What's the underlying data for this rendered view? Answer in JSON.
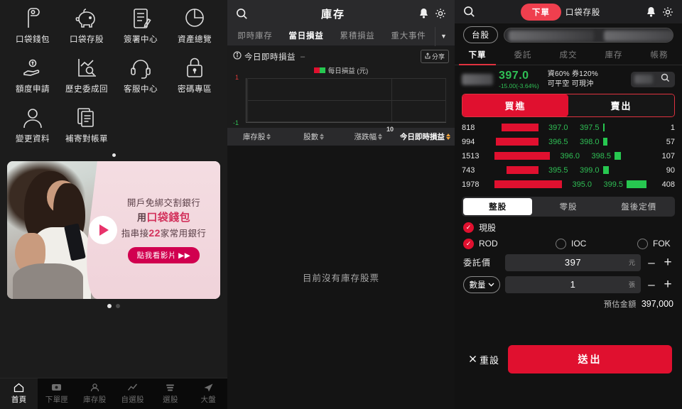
{
  "left": {
    "menu": [
      {
        "label": "口袋錢包",
        "icon": "wallet-icon"
      },
      {
        "label": "口袋存股",
        "icon": "piggy-bank-icon"
      },
      {
        "label": "簽署中心",
        "icon": "sign-document-icon"
      },
      {
        "label": "資產總覽",
        "icon": "pie-chart-icon"
      },
      {
        "label": "額度申請",
        "icon": "hand-coin-icon"
      },
      {
        "label": "歷史委成回",
        "icon": "chart-search-icon"
      },
      {
        "label": "客服中心",
        "icon": "headset-icon"
      },
      {
        "label": "密碼專區",
        "icon": "lock-icon"
      },
      {
        "label": "變更資料",
        "icon": "user-icon"
      },
      {
        "label": "補寄對帳單",
        "icon": "documents-icon"
      }
    ],
    "menu_pager": {
      "total": 1,
      "current": 1
    },
    "banner": {
      "line1": "開戶免綁交割銀行",
      "line2_pre": "用",
      "line2_strong": "口袋錢包",
      "line3_pre": "指串接",
      "line3_strong": "22",
      "line3_post": "家常用銀行",
      "cta": "點我看影片",
      "cta_arrow": "▶▶",
      "play_icon": "play-icon",
      "pager": {
        "total": 2,
        "current": 1
      }
    },
    "bottom_nav": [
      {
        "label": "首頁",
        "icon": "home-icon",
        "active": true
      },
      {
        "label": "下單匣",
        "icon": "order-box-icon",
        "active": false
      },
      {
        "label": "庫存股",
        "icon": "inventory-icon",
        "active": false
      },
      {
        "label": "自選股",
        "icon": "watchlist-chart-icon",
        "active": false
      },
      {
        "label": "選股",
        "icon": "stack-icon",
        "active": false
      },
      {
        "label": "大盤",
        "icon": "market-arrow-icon",
        "active": false
      }
    ]
  },
  "middle": {
    "header": {
      "title": "庫存",
      "search_icon": "search-icon",
      "bell_icon": "bell-icon",
      "gear_icon": "gear-icon"
    },
    "tabs": [
      {
        "label": "即時庫存",
        "active": false
      },
      {
        "label": "當日損益",
        "active": true
      },
      {
        "label": "累積損益",
        "active": false
      },
      {
        "label": "重大事件",
        "active": false
      }
    ],
    "tabs_more_icon": "chevron-down-icon",
    "chart_panel": {
      "info_icon": "info-icon",
      "title": "今日即時損益",
      "value": "–",
      "share_label": "分享",
      "share_icon": "share-icon"
    },
    "table_headers": [
      {
        "label": "庫存股",
        "active": false
      },
      {
        "label": "股數",
        "active": false
      },
      {
        "label": "漲跌幅",
        "active": false
      },
      {
        "label": "今日即時損益",
        "active": true
      }
    ],
    "empty_text": "目前沒有庫存股票"
  },
  "chart_data": {
    "type": "bar",
    "title": "今日即時損益",
    "legend": [
      "每日損益 (元)"
    ],
    "legend_colors": [
      "#e0102f",
      "#27c750"
    ],
    "categories": [],
    "values": [],
    "x": [
      10
    ],
    "xtick_labels": [
      "10"
    ],
    "ytick_labels": [
      "1",
      "-1"
    ],
    "ylim": [
      -1,
      1
    ],
    "ylabel": "",
    "xlabel": "",
    "grid": true,
    "legend_position": "top-center",
    "note": "No data plotted — empty inventory"
  },
  "right": {
    "header": {
      "search_icon": "search-icon",
      "bell_icon": "bell-icon",
      "gear_icon": "gear-icon",
      "seg_primary": "下單",
      "seg_secondary": "口袋存股"
    },
    "market_chip": "台股",
    "symbol_search_placeholder": "",
    "tabs": [
      {
        "label": "下單",
        "active": true
      },
      {
        "label": "委託",
        "active": false
      },
      {
        "label": "成交",
        "active": false
      },
      {
        "label": "庫存",
        "active": false
      },
      {
        "label": "帳務",
        "active": false
      }
    ],
    "quote": {
      "price": "397.0",
      "change": "-15.00(-3.64%)",
      "margin_line": "資60% 券120%",
      "flags_line": "可平空 可現沖",
      "search_icon": "search-icon"
    },
    "buy_label": "買進",
    "sell_label": "賣出",
    "order_book": {
      "bids": [
        {
          "qty": "818",
          "price": "397.0",
          "bar": 52
        },
        {
          "qty": "994",
          "price": "396.5",
          "bar": 60
        },
        {
          "qty": "1513",
          "price": "396.0",
          "bar": 78
        },
        {
          "qty": "743",
          "price": "395.5",
          "bar": 45
        },
        {
          "qty": "1978",
          "price": "395.0",
          "bar": 95
        }
      ],
      "asks": [
        {
          "price": "397.5",
          "qty": "1",
          "bar": 2
        },
        {
          "price": "398.0",
          "qty": "57",
          "bar": 6
        },
        {
          "price": "398.5",
          "qty": "107",
          "bar": 9
        },
        {
          "price": "399.0",
          "qty": "90",
          "bar": 8
        },
        {
          "price": "399.5",
          "qty": "408",
          "bar": 28
        }
      ]
    },
    "lot_tabs": [
      {
        "label": "整股",
        "active": true
      },
      {
        "label": "零股",
        "active": false
      },
      {
        "label": "盤後定價",
        "active": false
      }
    ],
    "trade_type": {
      "label": "現股",
      "checked": true
    },
    "order_conditions": [
      {
        "label": "ROD",
        "checked": true
      },
      {
        "label": "IOC",
        "checked": false
      },
      {
        "label": "FOK",
        "checked": false
      }
    ],
    "price_field": {
      "label": "委託價",
      "value": "397",
      "unit": "元",
      "minus": "–",
      "plus": "+"
    },
    "qty_field": {
      "chip": "數量",
      "chip_icon": "chevron-down-icon",
      "value": "1",
      "unit": "張",
      "minus": "–",
      "plus": "+"
    },
    "estimate": {
      "label": "預估金額",
      "value": "397,000"
    },
    "reset_label": "重設",
    "reset_icon": "close-icon",
    "submit_label": "送出"
  },
  "colors": {
    "accent_red": "#e0102f",
    "seg_red": "#ef3f4e",
    "green": "#2fbf55",
    "bar_green": "#27c750",
    "bg_dark": "#121212",
    "panel_gray": "#2a2a2c"
  }
}
